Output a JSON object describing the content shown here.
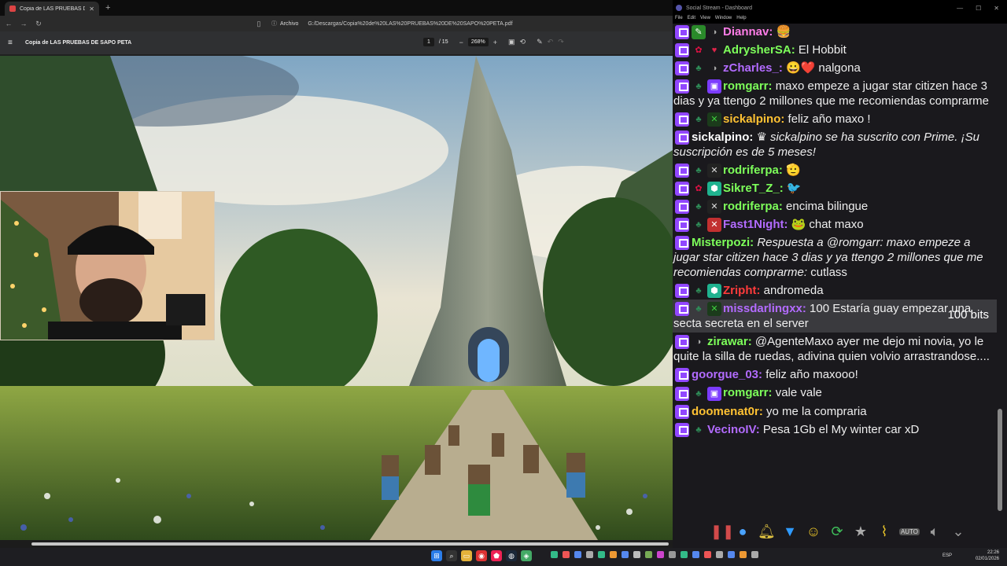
{
  "browser": {
    "tab_title": "Copia de LAS PRUEBAS DE SAPO",
    "address_scheme": "Archivo",
    "address_url": "G:/Descargas/Copia%20de%20LAS%20PRUEBAS%20DE%20SAPO%20PETA.pdf",
    "pdf_title": "Copia de LAS PRUEBAS DE SAPO PETA",
    "page_current": "1",
    "page_total": "/ 15",
    "zoom": "268%"
  },
  "chat_window": {
    "title": "Social Stream - Dashboard",
    "menu": [
      "File",
      "Edit",
      "View",
      "Window",
      "Help"
    ]
  },
  "messages": [
    {
      "user": "Diannav:",
      "user_color": "#ff7de8",
      "text": "",
      "badges": [
        "pen",
        "gray"
      ],
      "emote": "🍔"
    },
    {
      "user": "AdrysherSA:",
      "user_color": "#7dff5a",
      "text": "El Hobbit",
      "badges": [
        "mush",
        "heart"
      ],
      "emote": ""
    },
    {
      "user": "zCharles_:",
      "user_color": "#b26bff",
      "text": "nalgona",
      "badges": [
        "tree",
        "gray"
      ],
      "emote": "😀❤️"
    },
    {
      "user": "romgarr:",
      "user_color": "#7dff5a",
      "text": "maxo empeze a jugar star citizen hace 3 dias y ya ttengo 2 millones que me recomiendas comprarme",
      "badges": [
        "tree",
        "gift"
      ],
      "emote": ""
    },
    {
      "user": "sickalpino:",
      "user_color": "#ffc233",
      "text": "feliz año maxo !",
      "badges": [
        "tree",
        "x"
      ],
      "emote": ""
    },
    {
      "user": "sickalpino:",
      "user_color": "#ffffff",
      "text": "sickalpino se ha suscrito con Prime. ¡Su suscripción es de 5 meses!",
      "badges": [],
      "emote": "♛",
      "italic": true
    },
    {
      "user": "rodriferpa:",
      "user_color": "#7dff5a",
      "text": "",
      "badges": [
        "tree",
        "mute"
      ],
      "emote": "🫡"
    },
    {
      "user": "SikreT_Z_:",
      "user_color": "#7dff5a",
      "text": "",
      "badges": [
        "mush",
        "teal"
      ],
      "emote": "🐦"
    },
    {
      "user": "rodriferpa:",
      "user_color": "#7dff5a",
      "text": "encima bilingue",
      "badges": [
        "tree",
        "mute"
      ],
      "emote": ""
    },
    {
      "user": "Fast1Night:",
      "user_color": "#b26bff",
      "text": "chat maxo",
      "badges": [
        "tree",
        "red"
      ],
      "emote": "🐸"
    },
    {
      "user": "Misterpozi:",
      "user_color": "#7dff5a",
      "text": "Respuesta a @romgarr: maxo empeze a jugar star citizen hace 3 dias y ya ttengo 2 millones que me recomiendas comprarme:",
      "text2": "cutlass",
      "badges": [],
      "emote": "",
      "italic": true
    },
    {
      "user": "Zripht:",
      "user_color": "#ff3b3b",
      "text": "andromeda",
      "badges": [
        "tree",
        "teal"
      ],
      "emote": ""
    },
    {
      "user": "missdarlingxx:",
      "user_color": "#b26bff",
      "text": "100 Estaría guay empezar una secta secreta en el server",
      "badges": [
        "tree",
        "x"
      ],
      "emote": "",
      "bits": "100 bits",
      "highlight": true
    },
    {
      "user": "zirawar:",
      "user_color": "#7dff5a",
      "text": "@AgenteMaxo ayer me dejo mi novia, yo le quite la silla de ruedas, adivina quien volvio arrastrandose....",
      "badges": [
        "gray"
      ],
      "emote": ""
    },
    {
      "user": "goorgue_03:",
      "user_color": "#b26bff",
      "text": "feliz año maxooo!",
      "badges": [],
      "emote": ""
    },
    {
      "user": "romgarr:",
      "user_color": "#7dff5a",
      "text": "vale vale",
      "badges": [
        "tree",
        "gift"
      ],
      "emote": ""
    },
    {
      "user": "doomenat0r:",
      "user_color": "#ffc233",
      "text": "yo me la compraria",
      "badges": [],
      "emote": ""
    },
    {
      "user": "VecinoIV:",
      "user_color": "#b26bff",
      "text": "Pesa 1Gb el My winter car xD",
      "badges": [
        "tree"
      ],
      "emote": ""
    }
  ],
  "toolbar": {
    "auto_label": "AUTO"
  },
  "taskbar": {
    "lang": "ESP",
    "time": "22:26",
    "date": "02/01/2026"
  },
  "colors": {
    "twitch": "#9147ff",
    "chat_bg": "#1a191d"
  }
}
